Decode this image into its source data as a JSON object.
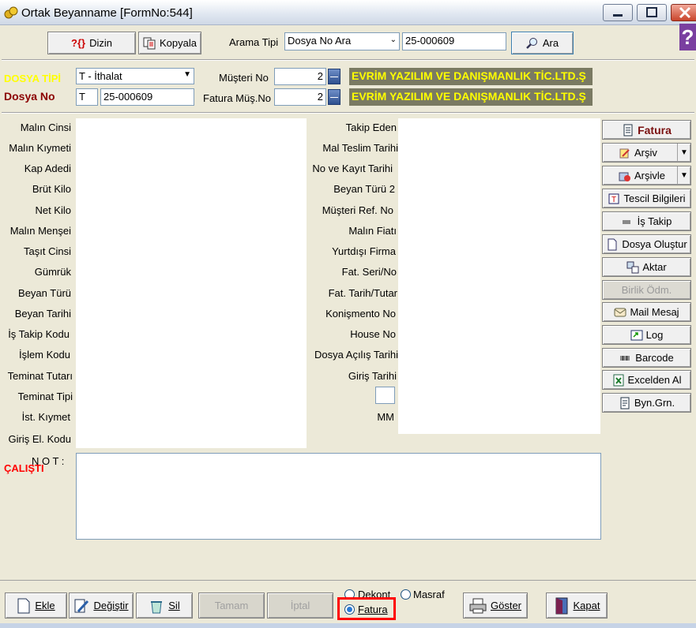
{
  "window": {
    "title": "Ortak Beyanname [FormNo:544]"
  },
  "toolbar": {
    "dizin_label": "Dizin",
    "kopyala_label": "Kopyala",
    "arama_tipi_label": "Arama Tipi",
    "arama_tipi_value": "Dosya No Ara",
    "search_value": "25-000609",
    "ara_label": "Ara"
  },
  "header": {
    "dosya_tipi_label": "DOSYA TİPİ",
    "dosya_tipi_value": "T - İthalat",
    "dosya_no_label": "Dosya No",
    "dosya_no_prefix": "T",
    "dosya_no_value": "25-000609",
    "musteri_no_label": "Müşteri No",
    "musteri_no_value": "2",
    "musteri_name": "EVRİM YAZILIM VE DANIŞMANLIK TİC.LTD.Ş",
    "fatura_musno_label": "Fatura Müş.No",
    "fatura_musno_value": "2",
    "fatura_mus_name": "EVRİM YAZILIM VE DANIŞMANLIK TİC.LTD.Ş"
  },
  "left_labels": [
    "Malın Cinsi",
    "Malın Kıymeti",
    "Kap Adedi",
    "Brüt Kilo",
    "Net Kilo",
    "Malın Menşei",
    "Taşıt Cinsi",
    "Gümrük",
    "Beyan Türü",
    "Beyan Tarihi",
    "İş Takip Kodu",
    "İşlem Kodu",
    "Teminat Tutarı",
    "Teminat Tipi",
    "İst. Kıymet",
    "Giriş El. Kodu"
  ],
  "mid_labels": [
    "Takip Eden",
    "Mal Teslim Tarihi",
    "No  ve Kayıt Tarihi",
    "Beyan Türü 2",
    "Müşteri  Ref. No",
    "Malın Fiatı",
    "Yurtdışı Firma",
    "Fat. Seri/No",
    "Fat. Tarih/Tutar",
    "Konişmento No",
    "House No",
    "Dosya Açılış Tarihi",
    "Giriş Tarihi",
    "",
    "MM"
  ],
  "side_buttons": {
    "fatura": "Fatura",
    "arsiv": "Arşiv",
    "arsivle": "Arşivle",
    "tescil": "Tescil Bilgileri",
    "is_takip": "İş Takip",
    "dosya_olustur": "Dosya Oluştur",
    "aktar": "Aktar",
    "birlik_odm": "Birlik Ödm.",
    "mail_mesaj": "Mail Mesaj",
    "log": "Log",
    "barcode": "Barcode",
    "excelden_al": "Excelden Al",
    "byn_grn": "Byn.Grn."
  },
  "note": {
    "label": "N O T :",
    "status": "ÇALIŞTI"
  },
  "bottom": {
    "ekle": "Ekle",
    "degistir": "Değiştir",
    "sil": "Sil",
    "tamam": "Tamam",
    "iptal": "İptal",
    "dekont": "Dekont",
    "masraf": "Masraf",
    "fatura": "Fatura",
    "goster": "Göster",
    "kapat": "Kapat"
  },
  "colors": {
    "accent_yellow": "#ffff00",
    "dosya_no_color": "#8b0000",
    "status_red": "#ff0000",
    "highlight_red": "#ff0000"
  }
}
